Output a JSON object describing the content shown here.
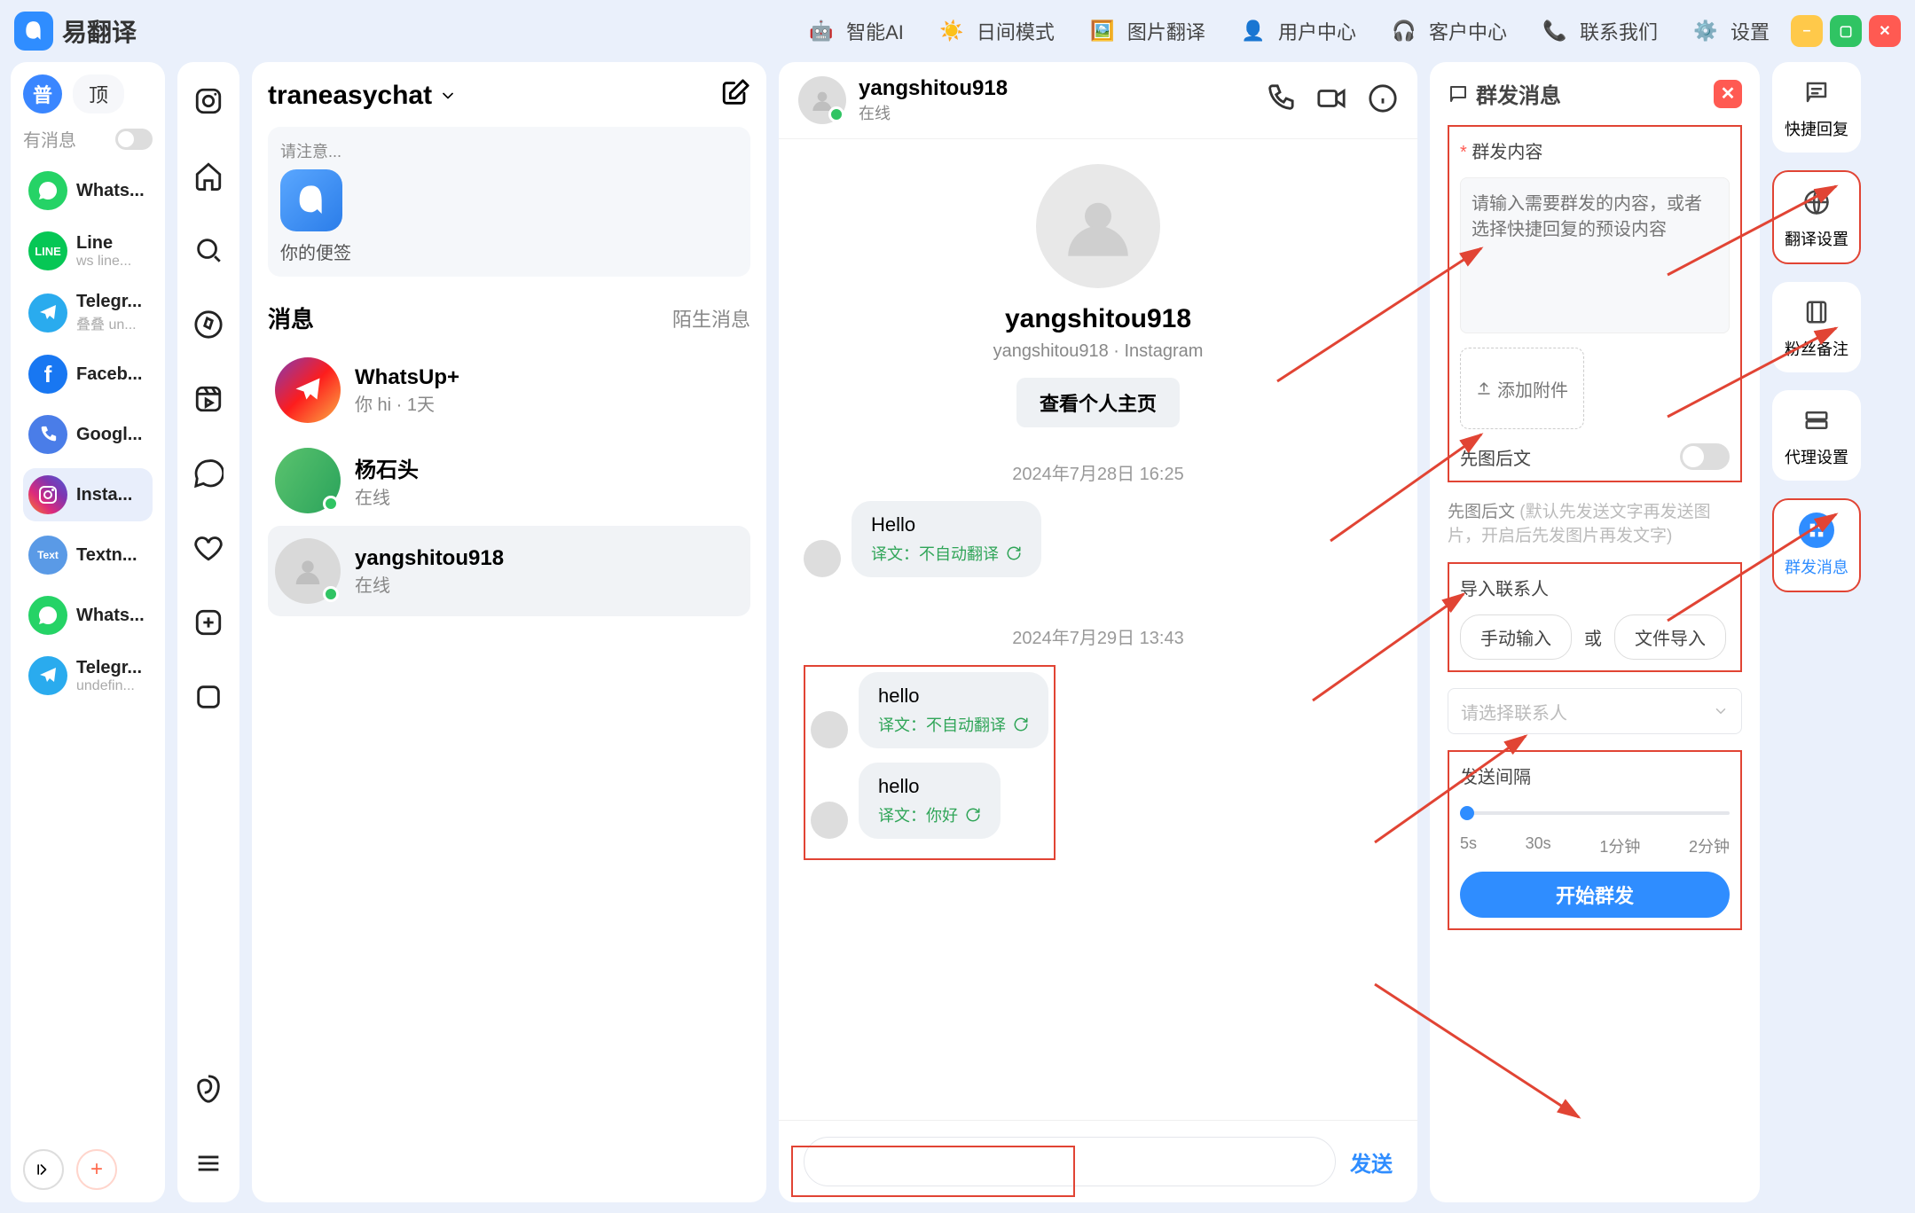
{
  "app": {
    "name": "易翻译"
  },
  "topnav": {
    "ai": "智能AI",
    "day_mode": "日间模式",
    "image_trans": "图片翻译",
    "user_center": "用户中心",
    "service_center": "客户中心",
    "contact_us": "联系我们",
    "settings": "设置"
  },
  "window_controls": {
    "min": "–",
    "max": "◻",
    "close": "×"
  },
  "accounts": {
    "pu_badge": "普",
    "top_btn": "顶",
    "has_msg_label": "有消息",
    "list": [
      {
        "name": "Whats...",
        "sub": " "
      },
      {
        "name": "Line",
        "sub": "ws line..."
      },
      {
        "name": "Telegr...",
        "sub": "叠叠 un..."
      },
      {
        "name": "Faceb...",
        "sub": " "
      },
      {
        "name": "Googl...",
        "sub": " "
      },
      {
        "name": "Insta...",
        "sub": " "
      },
      {
        "name": "Textn...",
        "sub": " "
      },
      {
        "name": "Whats...",
        "sub": " "
      },
      {
        "name": "Telegr...",
        "sub": "undefin..."
      }
    ],
    "add": "+"
  },
  "chatlist": {
    "title": "traneasychat",
    "note_small": "请注意...",
    "note_label": "你的便签",
    "section_title": "消息",
    "section_stranger": "陌生消息",
    "items": [
      {
        "name": "WhatsUp+",
        "sub": "你 hi · 1天"
      },
      {
        "name": "杨石头",
        "sub": "在线"
      },
      {
        "name": "yangshitou918",
        "sub": "在线"
      }
    ]
  },
  "conversation": {
    "name": "yangshitou918",
    "status": "在线",
    "profile_title": "yangshitou918",
    "profile_sub": "yangshitou918 · Instagram",
    "profile_btn": "查看个人主页",
    "date1": "2024年7月28日 16:25",
    "date2": "2024年7月29日 13:43",
    "msgs": [
      {
        "text": "Hello",
        "trans": "译文：不自动翻译"
      },
      {
        "text": "hello",
        "trans": "译文：不自动翻译"
      },
      {
        "text": "hello",
        "trans": "译文：你好"
      }
    ],
    "send": "发送"
  },
  "broadcast": {
    "title": "群发消息",
    "content_label": "群发内容",
    "placeholder": "请输入需要群发的内容，或者选择快捷回复的预设内容",
    "attach": "添加附件",
    "img_first": "先图后文",
    "img_first_desc": "先图后文",
    "img_first_desc2": "(默认先发送文字再发送图片，开启后先发图片再发文字)",
    "import_label": "导入联系人",
    "manual": "手动输入",
    "or": "或",
    "file_import": "文件导入",
    "select_placeholder": "请选择联系人",
    "interval_label": "发送间隔",
    "slider": [
      "5s",
      "30s",
      "1分钟",
      "2分钟"
    ],
    "start": "开始群发"
  },
  "rrail": [
    {
      "label": "快捷回复"
    },
    {
      "label": "翻译设置"
    },
    {
      "label": "粉丝备注"
    },
    {
      "label": "代理设置"
    },
    {
      "label": "群发消息"
    }
  ],
  "colors": {
    "primary": "#2f8dff",
    "red": "#e14434",
    "green": "#30c463"
  }
}
